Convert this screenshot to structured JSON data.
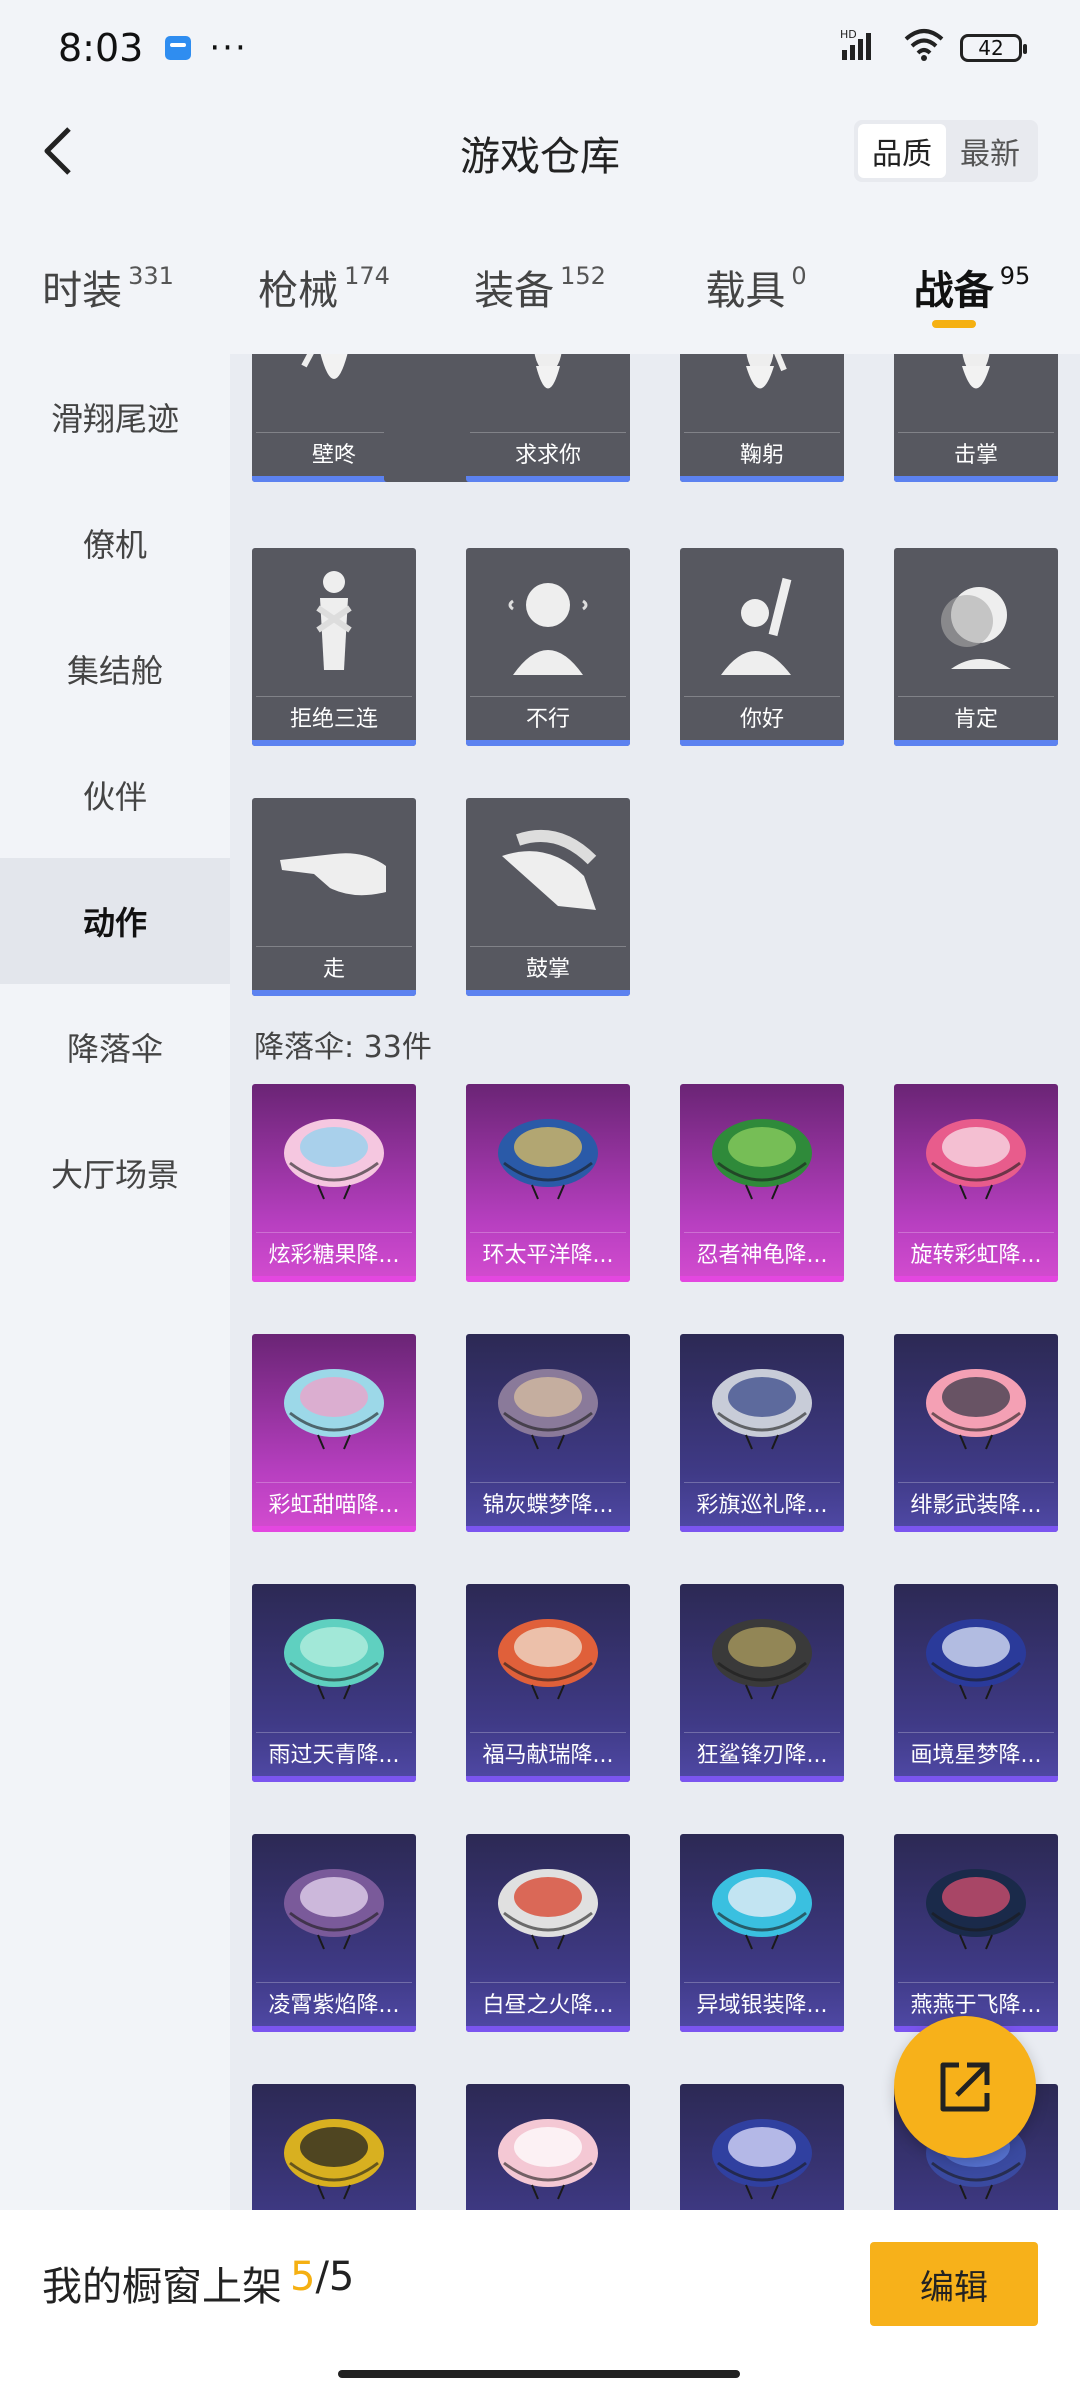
{
  "status_bar": {
    "time": "8:03",
    "dots": "···",
    "signal_label": "HD",
    "battery": "42"
  },
  "header": {
    "title": "游戏仓库",
    "sort_options": [
      "品质",
      "最新"
    ],
    "active_sort": "品质"
  },
  "top_tabs": [
    {
      "label": "时装",
      "count": "331"
    },
    {
      "label": "枪械",
      "count": "174"
    },
    {
      "label": "装备",
      "count": "152"
    },
    {
      "label": "载具",
      "count": "0"
    },
    {
      "label": "战备",
      "count": "95"
    }
  ],
  "active_tab": "战备",
  "sidebar": {
    "items": [
      "滑翔尾迹",
      "僚机",
      "集结舱",
      "伙伴",
      "动作",
      "降落伞",
      "大厅场景"
    ],
    "active": "动作"
  },
  "emotes": [
    {
      "name": "壁咚"
    },
    {
      "name": "求求你"
    },
    {
      "name": "鞠躬"
    },
    {
      "name": "击掌"
    },
    {
      "name": "拒绝三连"
    },
    {
      "name": "不行"
    },
    {
      "name": "你好"
    },
    {
      "name": "肯定"
    },
    {
      "name": "走"
    },
    {
      "name": "鼓掌"
    }
  ],
  "parachute_section_label": "降落伞: 33件",
  "parachutes": [
    {
      "name": "炫彩糖果降...",
      "rarity": "pink"
    },
    {
      "name": "环太平洋降...",
      "rarity": "pink"
    },
    {
      "name": "忍者神龟降...",
      "rarity": "pink"
    },
    {
      "name": "旋转彩虹降...",
      "rarity": "pink"
    },
    {
      "name": "彩虹甜喵降...",
      "rarity": "pink"
    },
    {
      "name": "锦灰蝶梦降...",
      "rarity": "purple"
    },
    {
      "name": "彩旗巡礼降...",
      "rarity": "purple"
    },
    {
      "name": "绯影武装降...",
      "rarity": "purple"
    },
    {
      "name": "雨过天青降...",
      "rarity": "purple"
    },
    {
      "name": "福马献瑞降...",
      "rarity": "purple"
    },
    {
      "name": "狂鲨锋刃降...",
      "rarity": "purple"
    },
    {
      "name": "画境星梦降...",
      "rarity": "purple"
    },
    {
      "name": "凌霄紫焰降...",
      "rarity": "purple"
    },
    {
      "name": "白昼之火降...",
      "rarity": "purple"
    },
    {
      "name": "异域银装降...",
      "rarity": "purple"
    },
    {
      "name": "燕燕于飞降...",
      "rarity": "purple"
    },
    {
      "name": "",
      "rarity": "purple"
    },
    {
      "name": "",
      "rarity": "purple"
    },
    {
      "name": "",
      "rarity": "purple"
    },
    {
      "name": "",
      "rarity": "purple"
    }
  ],
  "bottom_bar": {
    "showcase_label": "我的橱窗上架",
    "showcase_count": "5",
    "showcase_total": "/5",
    "edit_label": "编辑"
  },
  "icons": {
    "back": "back-chevron-icon",
    "share": "share-external-icon"
  },
  "colors": {
    "accent": "#f7b11a",
    "epic_pink": "#d44cd0",
    "rare_purple": "#5049a6",
    "emote_blue": "#5c82f0"
  }
}
